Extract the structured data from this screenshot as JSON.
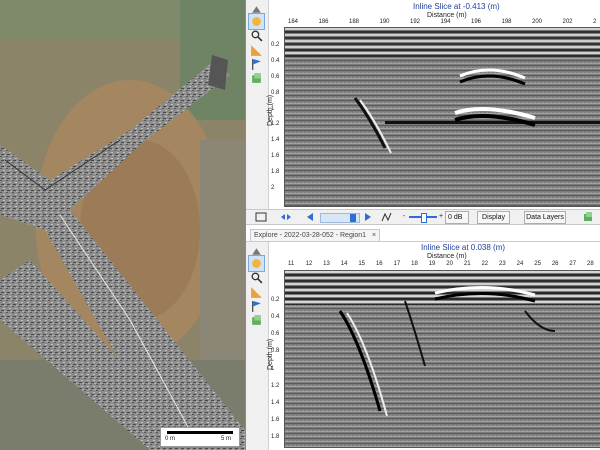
{
  "map": {
    "scale_start": "0 m",
    "scale_end": "5 m"
  },
  "top_panel": {
    "title": "Inline Slice at -0.413 (m)",
    "x_axis_label": "Distance (m)",
    "y_axis_label": "Depth (m)",
    "x_ticks": [
      "184",
      "186",
      "188",
      "190",
      "192",
      "194",
      "196",
      "198",
      "200",
      "202",
      "2"
    ],
    "y_ticks": [
      "0.2",
      "0.4",
      "0.6",
      "0.8",
      "1",
      "1.2",
      "1.4",
      "1.6",
      "1.8",
      "2"
    ]
  },
  "toolbar": {
    "gain_value": "0 dB",
    "display_label": "Display",
    "data_layers_label": "Data Layers",
    "minus": "-",
    "plus": "+"
  },
  "tab": {
    "label": "Explore - 2022-03-28-052 - Region1",
    "close": "×"
  },
  "bottom_panel": {
    "title": "Inline Slice at 0.038 (m)",
    "x_axis_label": "Distance (m)",
    "y_axis_label": "Depth (m)",
    "x_ticks": [
      "11",
      "12",
      "13",
      "14",
      "15",
      "16",
      "17",
      "18",
      "19",
      "20",
      "21",
      "22",
      "23",
      "24",
      "25",
      "26",
      "27",
      "28"
    ],
    "y_ticks": [
      "0.2",
      "0.4",
      "0.6",
      "0.8",
      "1",
      "1.2",
      "1.4",
      "1.6",
      "1.8"
    ]
  },
  "colors": {
    "title_blue": "#1f3d99",
    "active_button": "#cfe3f7"
  },
  "icons": [
    "triangle-up-icon",
    "pan-hand-icon",
    "zoom-icon",
    "ruler-icon",
    "flag-icon",
    "layers-icon"
  ]
}
